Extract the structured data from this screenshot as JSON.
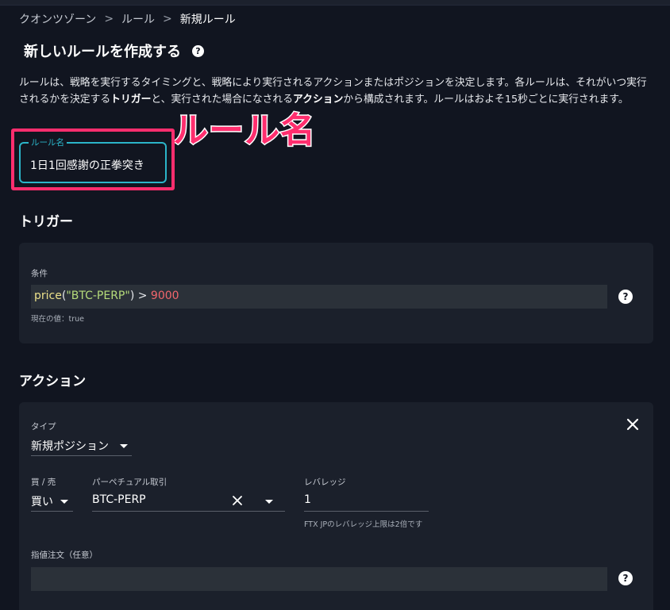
{
  "breadcrumb": {
    "items": [
      "クオンツゾーン",
      "ルール",
      "新規ルール"
    ],
    "separator": ">"
  },
  "page": {
    "title": "新しいルールを作成する",
    "help_icon": "question-icon",
    "description_part1": "ルールは、戦略を実行するタイミングと、戦略により実行されるアクションまたはポジションを決定します。各ルールは、それがいつ実行されるかを決定する",
    "description_trigger": "トリガー",
    "description_part2": "と、実行された場合になされる",
    "description_action": "アクション",
    "description_part3": "から構成されます。ルールはおよそ15秒ごとに実行されます。"
  },
  "annotation": {
    "label": "ルール名",
    "color": "#ff2e6e"
  },
  "rule_name": {
    "label": "ルール名",
    "value": "1日1回感謝の正拳突き"
  },
  "trigger": {
    "section_title": "トリガー",
    "condition_label": "条件",
    "code_fn": "price",
    "code_open": "(",
    "code_arg": "\"BTC-PERP\"",
    "code_close": ")",
    "code_op": " > ",
    "code_value": "9000",
    "current_value": "現在の値：true"
  },
  "action": {
    "section_title": "アクション",
    "type_label": "タイプ",
    "type_value": "新規ポジション",
    "side_label": "買 / 売",
    "side_value": "買い",
    "market_label": "パーペチュアル取引",
    "market_value": "BTC-PERP",
    "leverage_label": "レバレッジ",
    "leverage_value": "1",
    "leverage_note": "FTX JPのレバレッジ上限は2倍です",
    "limit_label": "指値注文（任意）",
    "limit_value": ""
  },
  "colors": {
    "background": "#111520",
    "card": "#1b202b",
    "accent_teal": "#2bb5c9",
    "callout_pink": "#ff2e6e",
    "code_function": "#ebe08a",
    "code_string": "#b5dc7a",
    "code_number": "#f2666c"
  }
}
